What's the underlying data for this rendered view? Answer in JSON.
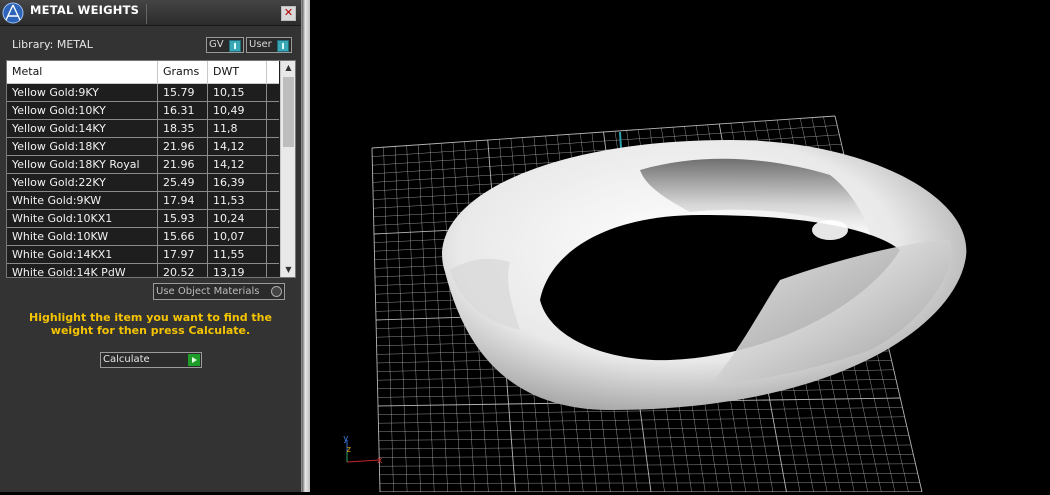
{
  "panel": {
    "title": "METAL WEIGHTS",
    "close": "✕",
    "library_label": "Library: METAL",
    "toggles": [
      "GV",
      "User"
    ],
    "table": {
      "columns": [
        "Metal",
        "Grams",
        "DWT"
      ],
      "rows": [
        {
          "metal": "Yellow Gold:9KY",
          "grams": "15.79",
          "dwt": "10,15"
        },
        {
          "metal": "Yellow Gold:10KY",
          "grams": "16.31",
          "dwt": "10,49"
        },
        {
          "metal": "Yellow Gold:14KY",
          "grams": "18.35",
          "dwt": "11,8"
        },
        {
          "metal": "Yellow Gold:18KY",
          "grams": "21.96",
          "dwt": "14,12"
        },
        {
          "metal": "Yellow Gold:18KY Royal",
          "grams": "21.96",
          "dwt": "14,12"
        },
        {
          "metal": "Yellow Gold:22KY",
          "grams": "25.49",
          "dwt": "16,39"
        },
        {
          "metal": "White Gold:9KW",
          "grams": "17.94",
          "dwt": "11,53"
        },
        {
          "metal": "White Gold:10KX1",
          "grams": "15.93",
          "dwt": "10,24"
        },
        {
          "metal": "White Gold:10KW",
          "grams": "15.66",
          "dwt": "10,07"
        },
        {
          "metal": "White Gold:14KX1",
          "grams": "17.97",
          "dwt": "11,55"
        },
        {
          "metal": "White Gold:14K PdW",
          "grams": "20.52",
          "dwt": "13,19"
        }
      ]
    },
    "use_object_materials": "Use Object Materials",
    "hint": "Highlight the item you want to find the weight for then press Calculate.",
    "calculate_label": "Calculate"
  },
  "viewport": {
    "axis_labels": {
      "y": "y",
      "z": "z",
      "x": "x"
    },
    "colors": {
      "grid": "#bfbfbf",
      "axis_line": "#2aa3b2",
      "model": "#f2f2f2"
    }
  }
}
